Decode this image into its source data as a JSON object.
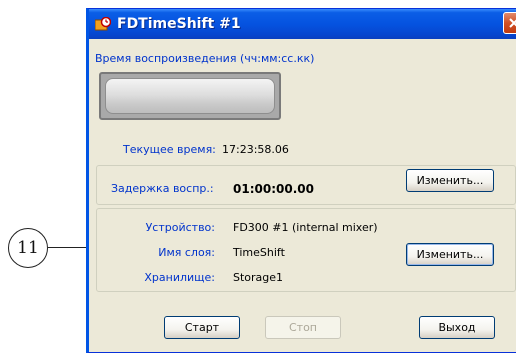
{
  "window": {
    "title": "FDTimeShift #1",
    "close_symbol": "✕"
  },
  "playback": {
    "label": "Время воспроизведения (чч:мм:сс.кк)",
    "current_time_label": "Текущее время:",
    "current_time_value": "17:23:58.06"
  },
  "delay": {
    "label": "Задержка воспр.:",
    "value": "01:00:00.00",
    "edit_label": "Изменить..."
  },
  "device": {
    "rows": [
      {
        "label": "Устройство:",
        "value": "FD300 #1 (internal mixer)"
      },
      {
        "label": "Имя слоя:",
        "value": "TimeShift"
      },
      {
        "label": "Хранилище:",
        "value": "Storage1"
      }
    ],
    "edit_label": "Изменить..."
  },
  "buttons": {
    "start": "Старт",
    "stop": "Стоп",
    "exit": "Выход"
  },
  "callout": {
    "number": "11"
  },
  "colors": {
    "label_blue": "#0033cc",
    "titlebar_blue": "#0553e0",
    "dialog_bg": "#ece9d8",
    "close_red": "#d05024"
  }
}
